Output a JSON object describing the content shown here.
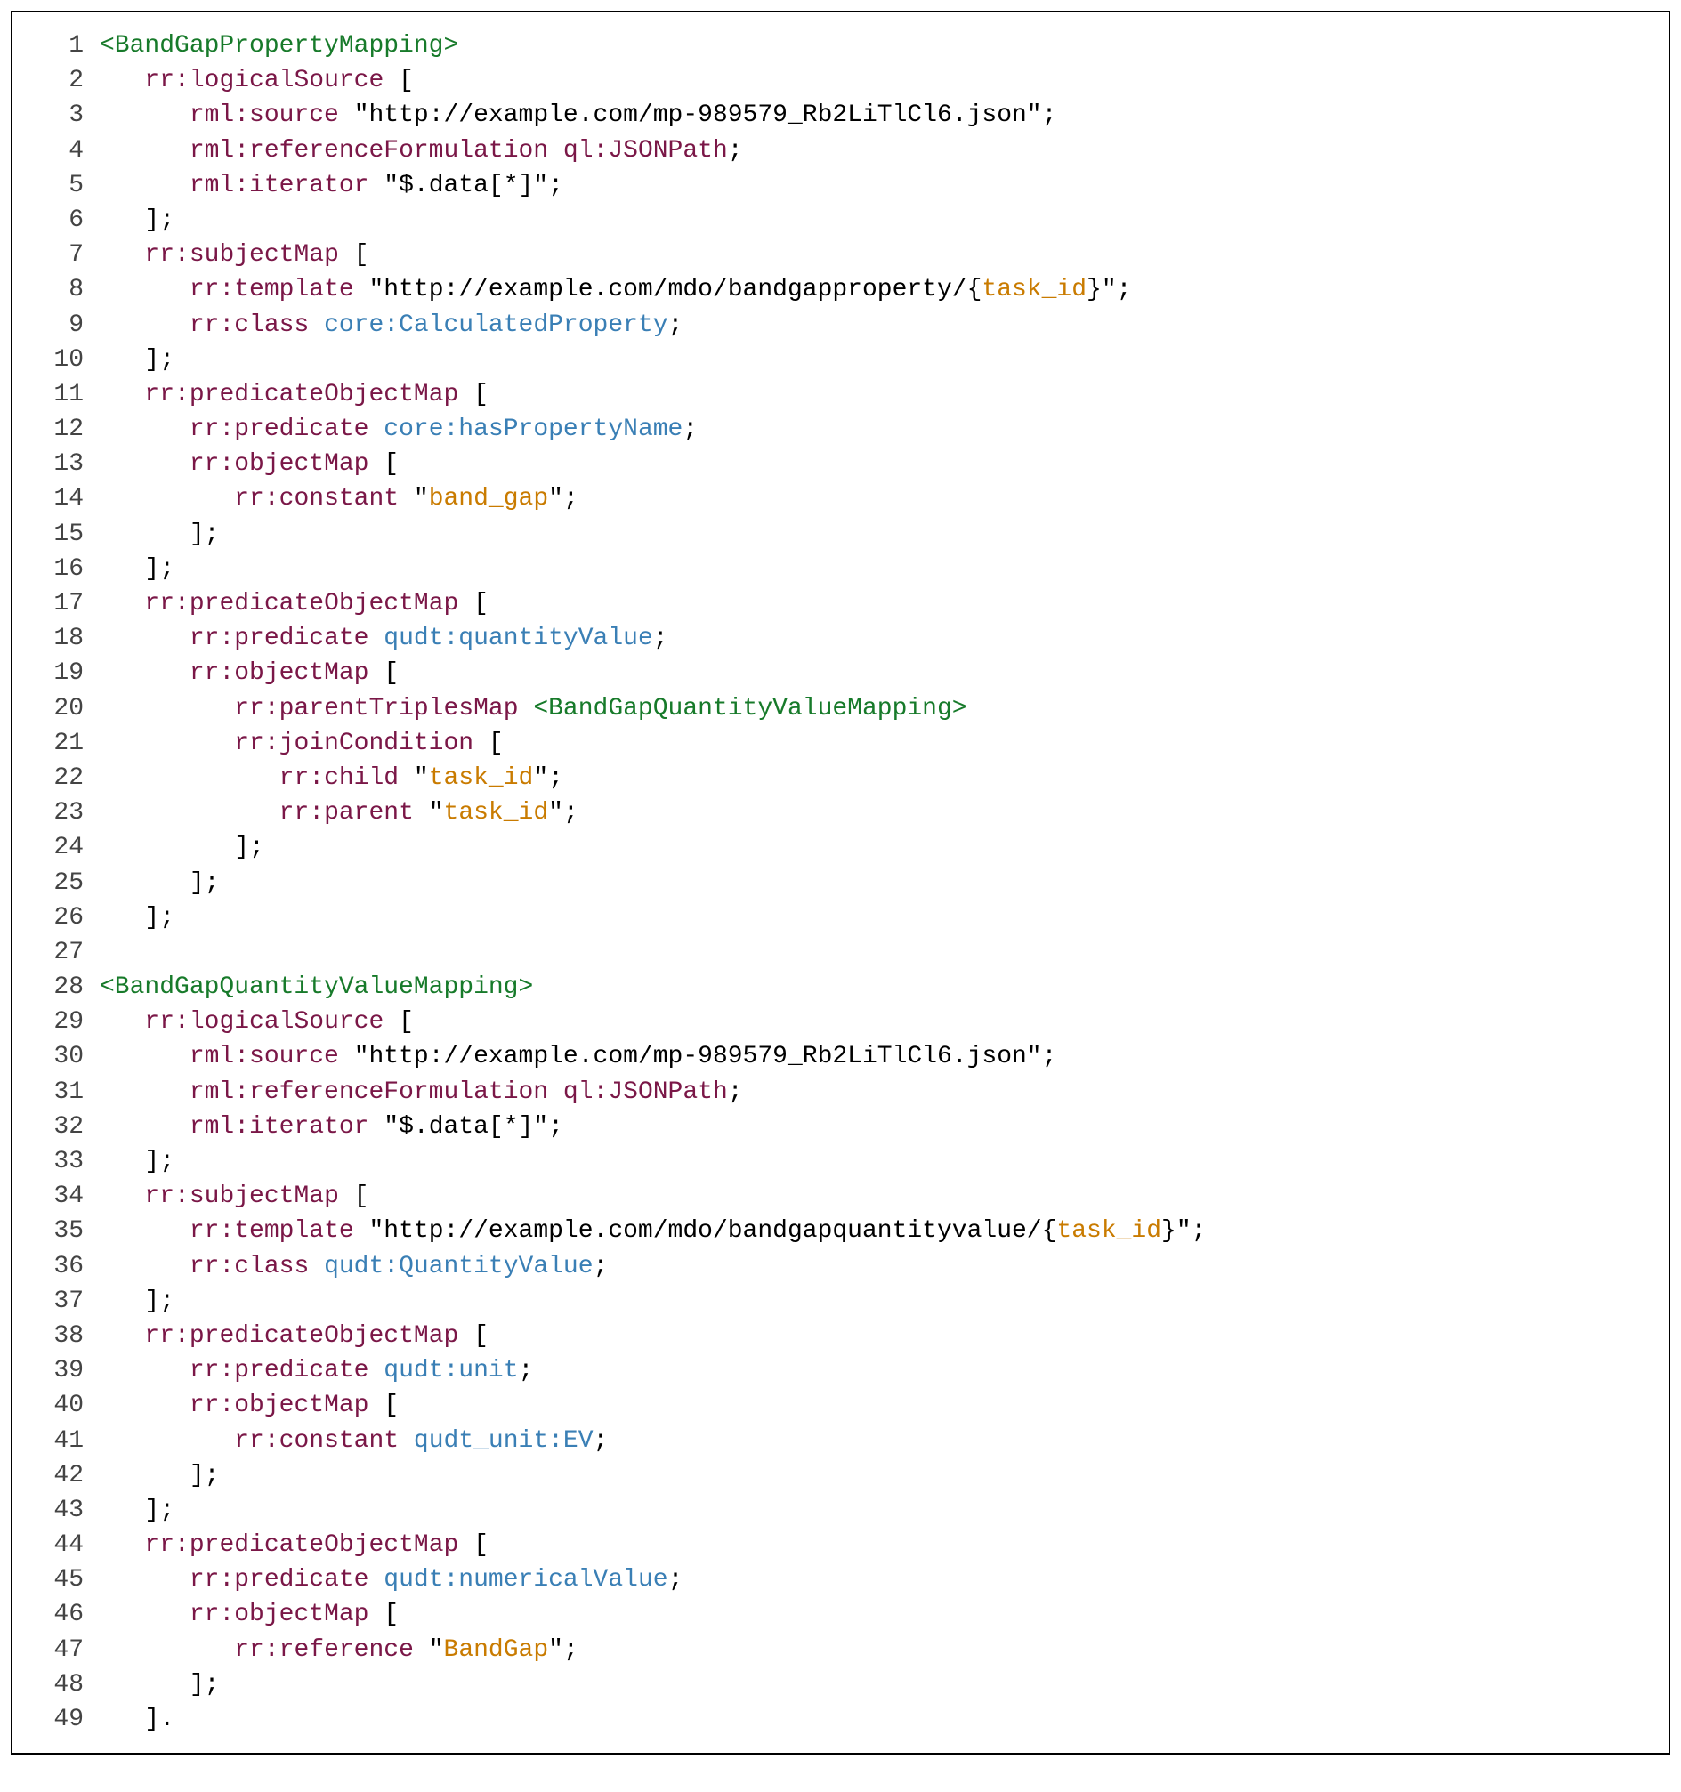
{
  "lines": [
    {
      "n": 1,
      "ind": 0,
      "tok": [
        {
          "t": "tag",
          "v": "<BandGapPropertyMapping>"
        }
      ]
    },
    {
      "n": 2,
      "ind": 1,
      "tok": [
        {
          "t": "prefix",
          "v": "rr:"
        },
        {
          "t": "term",
          "v": "logicalSource"
        },
        {
          "t": "punct",
          "v": " ["
        }
      ]
    },
    {
      "n": 3,
      "ind": 2,
      "tok": [
        {
          "t": "prefix",
          "v": "rml:"
        },
        {
          "t": "term",
          "v": "source"
        },
        {
          "t": "punct",
          "v": " "
        },
        {
          "t": "str",
          "v": "\"http://example.com/mp-989579_Rb2LiTlCl6.json\""
        },
        {
          "t": "punct",
          "v": ";"
        }
      ]
    },
    {
      "n": 4,
      "ind": 2,
      "tok": [
        {
          "t": "prefix",
          "v": "rml:"
        },
        {
          "t": "term",
          "v": "referenceFormulation"
        },
        {
          "t": "punct",
          "v": " "
        },
        {
          "t": "prefix",
          "v": "ql:"
        },
        {
          "t": "term",
          "v": "JSONPath"
        },
        {
          "t": "punct",
          "v": ";"
        }
      ]
    },
    {
      "n": 5,
      "ind": 2,
      "tok": [
        {
          "t": "prefix",
          "v": "rml:"
        },
        {
          "t": "term",
          "v": "iterator"
        },
        {
          "t": "punct",
          "v": " "
        },
        {
          "t": "str",
          "v": "\"$.data[*]\""
        },
        {
          "t": "punct",
          "v": ";"
        }
      ]
    },
    {
      "n": 6,
      "ind": 1,
      "tok": [
        {
          "t": "punct",
          "v": "];"
        }
      ]
    },
    {
      "n": 7,
      "ind": 1,
      "tok": [
        {
          "t": "prefix",
          "v": "rr:"
        },
        {
          "t": "term",
          "v": "subjectMap"
        },
        {
          "t": "punct",
          "v": " ["
        }
      ]
    },
    {
      "n": 8,
      "ind": 2,
      "tok": [
        {
          "t": "prefix",
          "v": "rr:"
        },
        {
          "t": "term",
          "v": "template"
        },
        {
          "t": "punct",
          "v": " "
        },
        {
          "t": "str",
          "v": "\"http://example.com/mdo/bandgapproperty/{"
        },
        {
          "t": "tmplvar",
          "v": "task_id"
        },
        {
          "t": "str",
          "v": "}\""
        },
        {
          "t": "punct",
          "v": ";"
        }
      ]
    },
    {
      "n": 9,
      "ind": 2,
      "tok": [
        {
          "t": "prefix",
          "v": "rr:"
        },
        {
          "t": "term",
          "v": "class"
        },
        {
          "t": "punct",
          "v": " "
        },
        {
          "t": "cls",
          "v": "core:CalculatedProperty"
        },
        {
          "t": "punct",
          "v": ";"
        }
      ]
    },
    {
      "n": 10,
      "ind": 1,
      "tok": [
        {
          "t": "punct",
          "v": "];"
        }
      ]
    },
    {
      "n": 11,
      "ind": 1,
      "tok": [
        {
          "t": "prefix",
          "v": "rr:"
        },
        {
          "t": "term",
          "v": "predicateObjectMap"
        },
        {
          "t": "punct",
          "v": " ["
        }
      ]
    },
    {
      "n": 12,
      "ind": 2,
      "tok": [
        {
          "t": "prefix",
          "v": "rr:"
        },
        {
          "t": "term",
          "v": "predicate"
        },
        {
          "t": "punct",
          "v": " "
        },
        {
          "t": "cls",
          "v": "core:hasPropertyName"
        },
        {
          "t": "punct",
          "v": ";"
        }
      ]
    },
    {
      "n": 13,
      "ind": 2,
      "tok": [
        {
          "t": "prefix",
          "v": "rr:"
        },
        {
          "t": "term",
          "v": "objectMap"
        },
        {
          "t": "punct",
          "v": " ["
        }
      ]
    },
    {
      "n": 14,
      "ind": 3,
      "tok": [
        {
          "t": "prefix",
          "v": "rr:"
        },
        {
          "t": "term",
          "v": "constant"
        },
        {
          "t": "punct",
          "v": " "
        },
        {
          "t": "str",
          "v": "\""
        },
        {
          "t": "tmplvar",
          "v": "band_gap"
        },
        {
          "t": "str",
          "v": "\""
        },
        {
          "t": "punct",
          "v": ";"
        }
      ]
    },
    {
      "n": 15,
      "ind": 2,
      "tok": [
        {
          "t": "punct",
          "v": "];"
        }
      ]
    },
    {
      "n": 16,
      "ind": 1,
      "tok": [
        {
          "t": "punct",
          "v": "];"
        }
      ]
    },
    {
      "n": 17,
      "ind": 1,
      "tok": [
        {
          "t": "prefix",
          "v": "rr:"
        },
        {
          "t": "term",
          "v": "predicateObjectMap"
        },
        {
          "t": "punct",
          "v": " ["
        }
      ]
    },
    {
      "n": 18,
      "ind": 2,
      "tok": [
        {
          "t": "prefix",
          "v": "rr:"
        },
        {
          "t": "term",
          "v": "predicate"
        },
        {
          "t": "punct",
          "v": " "
        },
        {
          "t": "cls",
          "v": "qudt:quantityValue"
        },
        {
          "t": "punct",
          "v": ";"
        }
      ]
    },
    {
      "n": 19,
      "ind": 2,
      "tok": [
        {
          "t": "prefix",
          "v": "rr:"
        },
        {
          "t": "term",
          "v": "objectMap"
        },
        {
          "t": "punct",
          "v": " ["
        }
      ]
    },
    {
      "n": 20,
      "ind": 3,
      "tok": [
        {
          "t": "prefix",
          "v": "rr:"
        },
        {
          "t": "term",
          "v": "parentTriplesMap"
        },
        {
          "t": "punct",
          "v": " "
        },
        {
          "t": "tag",
          "v": "<BandGapQuantityValueMapping>"
        }
      ]
    },
    {
      "n": 21,
      "ind": 3,
      "tok": [
        {
          "t": "prefix",
          "v": "rr:"
        },
        {
          "t": "term",
          "v": "joinCondition"
        },
        {
          "t": "punct",
          "v": " ["
        }
      ]
    },
    {
      "n": 22,
      "ind": 4,
      "tok": [
        {
          "t": "prefix",
          "v": "rr:"
        },
        {
          "t": "term",
          "v": "child"
        },
        {
          "t": "punct",
          "v": " "
        },
        {
          "t": "str",
          "v": "\""
        },
        {
          "t": "tmplvar",
          "v": "task_id"
        },
        {
          "t": "str",
          "v": "\""
        },
        {
          "t": "punct",
          "v": ";"
        }
      ]
    },
    {
      "n": 23,
      "ind": 4,
      "tok": [
        {
          "t": "prefix",
          "v": "rr:"
        },
        {
          "t": "term",
          "v": "parent"
        },
        {
          "t": "punct",
          "v": " "
        },
        {
          "t": "str",
          "v": "\""
        },
        {
          "t": "tmplvar",
          "v": "task_id"
        },
        {
          "t": "str",
          "v": "\""
        },
        {
          "t": "punct",
          "v": ";"
        }
      ]
    },
    {
      "n": 24,
      "ind": 3,
      "tok": [
        {
          "t": "punct",
          "v": "];"
        }
      ]
    },
    {
      "n": 25,
      "ind": 2,
      "tok": [
        {
          "t": "punct",
          "v": "];"
        }
      ]
    },
    {
      "n": 26,
      "ind": 1,
      "tok": [
        {
          "t": "punct",
          "v": "];"
        }
      ]
    },
    {
      "n": 27,
      "ind": 0,
      "tok": []
    },
    {
      "n": 28,
      "ind": 0,
      "tok": [
        {
          "t": "tag",
          "v": "<BandGapQuantityValueMapping>"
        }
      ]
    },
    {
      "n": 29,
      "ind": 1,
      "tok": [
        {
          "t": "prefix",
          "v": "rr:"
        },
        {
          "t": "term",
          "v": "logicalSource"
        },
        {
          "t": "punct",
          "v": " ["
        }
      ]
    },
    {
      "n": 30,
      "ind": 2,
      "tok": [
        {
          "t": "prefix",
          "v": "rml:"
        },
        {
          "t": "term",
          "v": "source"
        },
        {
          "t": "punct",
          "v": " "
        },
        {
          "t": "str",
          "v": "\"http://example.com/mp-989579_Rb2LiTlCl6.json\""
        },
        {
          "t": "punct",
          "v": ";"
        }
      ]
    },
    {
      "n": 31,
      "ind": 2,
      "tok": [
        {
          "t": "prefix",
          "v": "rml:"
        },
        {
          "t": "term",
          "v": "referenceFormulation"
        },
        {
          "t": "punct",
          "v": " "
        },
        {
          "t": "prefix",
          "v": "ql:"
        },
        {
          "t": "term",
          "v": "JSONPath"
        },
        {
          "t": "punct",
          "v": ";"
        }
      ]
    },
    {
      "n": 32,
      "ind": 2,
      "tok": [
        {
          "t": "prefix",
          "v": "rml:"
        },
        {
          "t": "term",
          "v": "iterator"
        },
        {
          "t": "punct",
          "v": " "
        },
        {
          "t": "str",
          "v": "\"$.data[*]\""
        },
        {
          "t": "punct",
          "v": ";"
        }
      ]
    },
    {
      "n": 33,
      "ind": 1,
      "tok": [
        {
          "t": "punct",
          "v": "];"
        }
      ]
    },
    {
      "n": 34,
      "ind": 1,
      "tok": [
        {
          "t": "prefix",
          "v": "rr:"
        },
        {
          "t": "term",
          "v": "subjectMap"
        },
        {
          "t": "punct",
          "v": " ["
        }
      ]
    },
    {
      "n": 35,
      "ind": 2,
      "tok": [
        {
          "t": "prefix",
          "v": "rr:"
        },
        {
          "t": "term",
          "v": "template"
        },
        {
          "t": "punct",
          "v": " "
        },
        {
          "t": "str",
          "v": "\"http://example.com/mdo/bandgapquantityvalue/{"
        },
        {
          "t": "tmplvar",
          "v": "task_id"
        },
        {
          "t": "str",
          "v": "}\""
        },
        {
          "t": "punct",
          "v": ";"
        }
      ]
    },
    {
      "n": 36,
      "ind": 2,
      "tok": [
        {
          "t": "prefix",
          "v": "rr:"
        },
        {
          "t": "term",
          "v": "class"
        },
        {
          "t": "punct",
          "v": " "
        },
        {
          "t": "cls",
          "v": "qudt:QuantityValue"
        },
        {
          "t": "punct",
          "v": ";"
        }
      ]
    },
    {
      "n": 37,
      "ind": 1,
      "tok": [
        {
          "t": "punct",
          "v": "];"
        }
      ]
    },
    {
      "n": 38,
      "ind": 1,
      "tok": [
        {
          "t": "prefix",
          "v": "rr:"
        },
        {
          "t": "term",
          "v": "predicateObjectMap"
        },
        {
          "t": "punct",
          "v": " ["
        }
      ]
    },
    {
      "n": 39,
      "ind": 2,
      "tok": [
        {
          "t": "prefix",
          "v": "rr:"
        },
        {
          "t": "term",
          "v": "predicate"
        },
        {
          "t": "punct",
          "v": " "
        },
        {
          "t": "cls",
          "v": "qudt:unit"
        },
        {
          "t": "punct",
          "v": ";"
        }
      ]
    },
    {
      "n": 40,
      "ind": 2,
      "tok": [
        {
          "t": "prefix",
          "v": "rr:"
        },
        {
          "t": "term",
          "v": "objectMap"
        },
        {
          "t": "punct",
          "v": " ["
        }
      ]
    },
    {
      "n": 41,
      "ind": 3,
      "tok": [
        {
          "t": "prefix",
          "v": "rr:"
        },
        {
          "t": "term",
          "v": "constant"
        },
        {
          "t": "punct",
          "v": " "
        },
        {
          "t": "cls",
          "v": "qudt_unit:EV"
        },
        {
          "t": "punct",
          "v": ";"
        }
      ]
    },
    {
      "n": 42,
      "ind": 2,
      "tok": [
        {
          "t": "punct",
          "v": "];"
        }
      ]
    },
    {
      "n": 43,
      "ind": 1,
      "tok": [
        {
          "t": "punct",
          "v": "];"
        }
      ]
    },
    {
      "n": 44,
      "ind": 1,
      "tok": [
        {
          "t": "prefix",
          "v": "rr:"
        },
        {
          "t": "term",
          "v": "predicateObjectMap"
        },
        {
          "t": "punct",
          "v": " ["
        }
      ]
    },
    {
      "n": 45,
      "ind": 2,
      "tok": [
        {
          "t": "prefix",
          "v": "rr:"
        },
        {
          "t": "term",
          "v": "predicate"
        },
        {
          "t": "punct",
          "v": " "
        },
        {
          "t": "cls",
          "v": "qudt:numericalValue"
        },
        {
          "t": "punct",
          "v": ";"
        }
      ]
    },
    {
      "n": 46,
      "ind": 2,
      "tok": [
        {
          "t": "prefix",
          "v": "rr:"
        },
        {
          "t": "term",
          "v": "objectMap"
        },
        {
          "t": "punct",
          "v": " ["
        }
      ]
    },
    {
      "n": 47,
      "ind": 3,
      "tok": [
        {
          "t": "prefix",
          "v": "rr:"
        },
        {
          "t": "term",
          "v": "reference"
        },
        {
          "t": "punct",
          "v": " "
        },
        {
          "t": "str",
          "v": "\""
        },
        {
          "t": "tmplvar",
          "v": "BandGap"
        },
        {
          "t": "str",
          "v": "\""
        },
        {
          "t": "punct",
          "v": ";"
        }
      ]
    },
    {
      "n": 48,
      "ind": 2,
      "tok": [
        {
          "t": "punct",
          "v": "];"
        }
      ]
    },
    {
      "n": 49,
      "ind": 1,
      "tok": [
        {
          "t": "punct",
          "v": "]."
        }
      ]
    }
  ],
  "indent_unit": "   "
}
